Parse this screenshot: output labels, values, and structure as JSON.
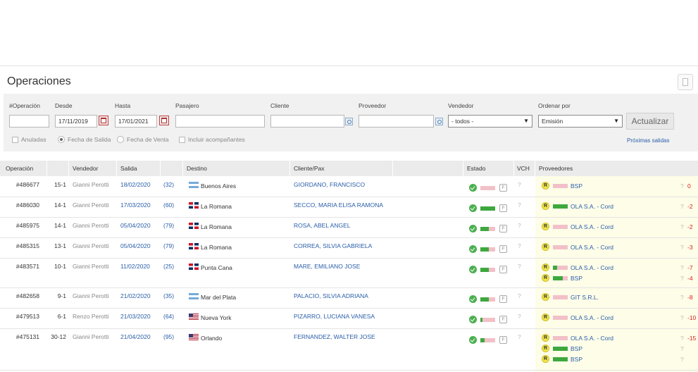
{
  "page": {
    "title": "Operaciones"
  },
  "filters": {
    "labels": {
      "operacion": "#Operación",
      "desde": "Desde",
      "hasta": "Hasta",
      "pasajero": "Pasajero",
      "cliente": "Cliente",
      "proveedor": "Proveedor",
      "vendedor": "Vendedor",
      "ordenar": "Ordenar por"
    },
    "desde_value": "17/11/2019",
    "hasta_value": "17/01/2021",
    "vendedor_value": "- todos -",
    "ordenar_value": "Emisión",
    "actualizar_label": "Actualizar",
    "opts": {
      "anuladas": "Anuladas",
      "fecha_salida": "Fecha de Salida",
      "fecha_venta": "Fecha de Venta",
      "incluir": "Incluir acompañantes"
    },
    "proximas_label": "Próximas salidas"
  },
  "table": {
    "headers": {
      "operacion": "Operación",
      "vendedor": "Vendedor",
      "salida": "Salida",
      "destino": "Destino",
      "cliente": "Cliente/Pax",
      "estado": "Estado",
      "vch": "VCH",
      "proveedores": "Proveedores"
    },
    "rows": [
      {
        "op": "#486677",
        "grp": "15-1",
        "vend": "Gianni Perotti",
        "salida": "18/02/2020",
        "dias": "(32)",
        "flag": "ar",
        "dest": "Buenos Aires",
        "cliente": "GIORDANO, FRANCISCO",
        "estado_pct": 0.0,
        "vch": "?",
        "prov": [
          {
            "pct": 0.0,
            "name": "BSP",
            "q": "?",
            "val": "0"
          }
        ]
      },
      {
        "op": "#486030",
        "grp": "14-1",
        "vend": "Gianni Perotti",
        "salida": "17/03/2020",
        "dias": "(60)",
        "flag": "do",
        "dest": "La Romana",
        "cliente": "SECCO, MARIA ELISA RAMONA",
        "estado_pct": 1.0,
        "vch": "?",
        "prov": [
          {
            "pct": 1.0,
            "name": "OLA S.A. - Cord",
            "q": "?",
            "val": "-2"
          }
        ]
      },
      {
        "op": "#485975",
        "grp": "14-1",
        "vend": "Gianni Perotti",
        "salida": "05/04/2020",
        "dias": "(79)",
        "flag": "do",
        "dest": "La Romana",
        "cliente": "ROSA, ABEL ANGEL",
        "estado_pct": 0.55,
        "vch": "?",
        "prov": [
          {
            "pct": 0.0,
            "name": "OLA S.A. - Cord",
            "q": "?",
            "val": "-2"
          }
        ]
      },
      {
        "op": "#485315",
        "grp": "13-1",
        "vend": "Gianni Perotti",
        "salida": "05/04/2020",
        "dias": "(79)",
        "flag": "do",
        "dest": "La Romana",
        "cliente": "CORREA, SILVIA GABRIELA",
        "estado_pct": 0.55,
        "vch": "?",
        "prov": [
          {
            "pct": 0.0,
            "name": "OLA S.A. - Cord",
            "q": "?",
            "val": "-3"
          }
        ]
      },
      {
        "op": "#483571",
        "grp": "10-1",
        "vend": "Gianni Perotti",
        "salida": "11/02/2020",
        "dias": "(25)",
        "flag": "do",
        "dest": "Punta Cana",
        "cliente": "MARE, EMILIANO JOSE",
        "estado_pct": 0.55,
        "vch": "?",
        "prov": [
          {
            "pct": 0.3,
            "name": "OLA S.A. - Cord",
            "q": "?",
            "val": "-7"
          },
          {
            "pct": 0.65,
            "name": "BSP",
            "q": "?",
            "val": "-4"
          }
        ]
      },
      {
        "op": "#482658",
        "grp": "9-1",
        "vend": "Gianni Perotti",
        "salida": "21/02/2020",
        "dias": "(35)",
        "flag": "ar",
        "dest": "Mar del Plata",
        "cliente": "PALACIO, SILVIA ADRIANA",
        "estado_pct": 0.55,
        "vch": "?",
        "prov": [
          {
            "pct": 0.0,
            "name": "GIT S.R.L.",
            "q": "?",
            "val": "-8"
          }
        ]
      },
      {
        "op": "#479513",
        "grp": "6-1",
        "vend": "Renzo Perotti",
        "salida": "21/03/2020",
        "dias": "(64)",
        "flag": "us",
        "dest": "Nueva York",
        "cliente": "PIZARRO, LUCIANA VANESA",
        "estado_pct": 0.15,
        "vch": "?",
        "prov": [
          {
            "pct": 0.0,
            "name": "OLA S.A. - Cord",
            "q": "?",
            "val": "-10"
          }
        ]
      },
      {
        "op": "#475131",
        "grp": "30-12",
        "vend": "Gianni Perotti",
        "salida": "21/04/2020",
        "dias": "(95)",
        "flag": "us",
        "dest": "Orlando",
        "cliente": "FERNANDEZ, WALTER JOSE",
        "estado_pct": 0.3,
        "vch": "?",
        "prov": [
          {
            "pct": 0.0,
            "name": "OLA S.A. - Cord",
            "q": "?",
            "val": "-15"
          },
          {
            "pct": 1.0,
            "name": "BSP",
            "q": "?",
            "val": ""
          },
          {
            "pct": 1.0,
            "name": "BSP",
            "q": "?",
            "val": ""
          }
        ]
      }
    ]
  },
  "colors": {
    "accent_link": "#2a5ea8",
    "ok_green": "#3ea83e",
    "pending_pink": "#f2c0c8",
    "negative": "#e02020",
    "provider_bg": "#fdfde8"
  }
}
